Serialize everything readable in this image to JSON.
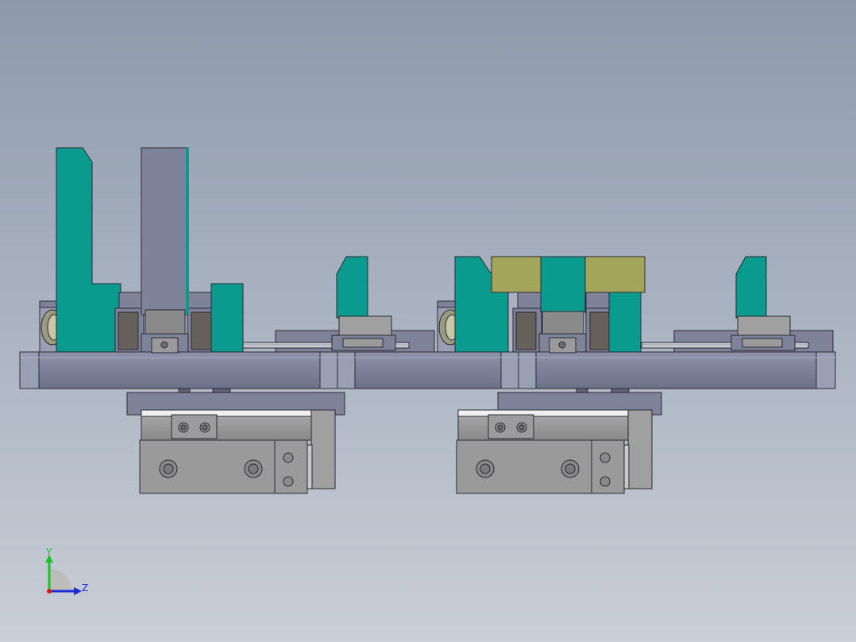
{
  "view": {
    "background_top": "#8e9aab",
    "background_bottom": "#c9ced7"
  },
  "colors": {
    "teal": "#0a9b8e",
    "teal_dark": "#087a70",
    "olive": "#a3a55b",
    "slate": "#7f839a",
    "slate_dark": "#5f6379",
    "slate_light": "#9aa0b4",
    "steel": "#9a9a9a",
    "steel_dark": "#6e6e6e",
    "brown": "#66605a",
    "outline": "#2a2a32",
    "rail": "#c8cbd0"
  },
  "triad": {
    "y_label": "Y",
    "z_label": "Z",
    "y_color": "#1fbf2a",
    "z_color": "#1b2bd6",
    "x_color": "#d61b1b"
  }
}
